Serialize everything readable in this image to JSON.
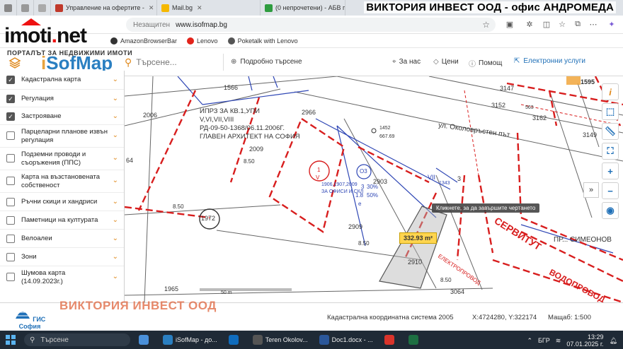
{
  "browser": {
    "tabs": [
      {
        "label": "Управление на офертите -",
        "icon_color": "#c0392b",
        "active": false
      },
      {
        "label": "Mail.bg",
        "icon_color": "#f5b800",
        "active": false
      },
      {
        "label": "(0 непрочетени) - АБВ поща",
        "icon_color": "#2e9c3f",
        "active": false
      }
    ],
    "overlay_title": "ВИКТОРИЯ ИНВЕСТ ООД - офис АНДРОМЕДА",
    "address": {
      "security_label": "Незащитен",
      "url": "www.isofmap.bg"
    },
    "bookmarks": [
      {
        "label": "AmazonBrowserBar",
        "icon_color": "#333333"
      },
      {
        "label": "Lenovo",
        "icon_color": "#e2231a"
      },
      {
        "label": "Poketalk with Lenovo",
        "icon_color": "#555555"
      }
    ]
  },
  "imoti_logo": {
    "text_main": "imoti",
    "text_dot": ".",
    "text_tld": "net",
    "subtitle": "ПОРТАЛЪТ ЗА НЕДВИЖИМИ ИМОТИ"
  },
  "app": {
    "logo_i": "i",
    "logo_rest": "SofMap",
    "search_placeholder": "Търсене...",
    "advanced_search": "Подробно търсене",
    "nav": {
      "about": "За нас",
      "prices": "Цени",
      "help": "Помощ"
    },
    "eservices": "Електронни услуги"
  },
  "layers": [
    {
      "label": "Кадастрална карта",
      "checked": true
    },
    {
      "label": "Регулация",
      "checked": true
    },
    {
      "label": "Застрояване",
      "checked": true
    },
    {
      "label": "Парцеларни планове извън регулация",
      "checked": false
    },
    {
      "label": "Подземни проводи и съоръжения (ППС)",
      "checked": false
    },
    {
      "label": "Карта на възстановената собственост",
      "checked": false
    },
    {
      "label": "Ръчни скици и хандриси",
      "checked": false
    },
    {
      "label": "Паметници на културата",
      "checked": false
    },
    {
      "label": "Велоалеи",
      "checked": false
    },
    {
      "label": "Зони",
      "checked": false
    },
    {
      "label": "Шумова карта (14.09.2023г.)",
      "checked": false
    }
  ],
  "map": {
    "labels": {
      "l1566": "1566",
      "l2006": "2006",
      "l2009": "2009",
      "l2966": "2966",
      "l2903": "2903",
      "l2909": "2909",
      "l2910": "2910",
      "l1965": "1965",
      "l3064": "3064",
      "l3147": "3147",
      "l3152": "3152",
      "l3149": "3149",
      "l1595": "1595",
      "l3162": "3162",
      "l563": "563",
      "l1452": "1452",
      "l667": "667.69",
      "l64": "64",
      "l850a": "8.50",
      "l850b": "8.50",
      "l850c": "8.50",
      "l850d": "8.50",
      "l1343": "1343",
      "lVII": "VII",
      "l3": "3",
      "lO3": "O3",
      "l1_": "1",
      "lV": "V",
      "l1972": "1972",
      "plan_text1": "ИПРЗ ЗА КВ.1,УПИ",
      "plan_text2": "V,VI,VII,VIII",
      "plan_text3": "РД-09-50-1368/06.11.2006Г.",
      "plan_text4": "ГЛАВЕН АРХИТЕКТ НА СОФИЯ",
      "street": "ул. Околовръстен път",
      "office_text1": "1906,1907,2009",
      "office_text2": "ЗА ОФИСИ И СКЛ",
      "pct1": "3",
      "pct1b": "30%",
      "pct2": "1.8",
      "pct2b": "50%",
      "pct3": "е",
      "servitut1": "СЕРВИТУТ",
      "servitut2": "ВОДОПРОВОД",
      "servitut3": "ЕЛЕКТРОПРОВОД",
      "simeon": "ПР... СИМЕОНОВ",
      "scale_bar": "50 m"
    },
    "tooltip": "Кликнете, за да завършите чертането",
    "measure_label": "332.93 m²"
  },
  "footer": {
    "gis_label": "ГИС София",
    "watermark": "ВИКТОРИЯ ИНВЕСТ ООД",
    "coord_system": "Кадастрална координатна система 2005",
    "coords": "X:4724280, Y:322174",
    "scale": "Мащаб: 1:500"
  },
  "taskbar": {
    "search": "Търсене",
    "apps": [
      {
        "label": "iSofMap - до...",
        "icon_color": "#2a7fc1"
      },
      {
        "label": "Teren Okolov...",
        "icon_color": "#555555"
      },
      {
        "label": "Doc1.docx - ...",
        "icon_color": "#2b579a"
      }
    ],
    "lang": "БГР",
    "time": "13:29",
    "date": "07.01.2025 г."
  }
}
